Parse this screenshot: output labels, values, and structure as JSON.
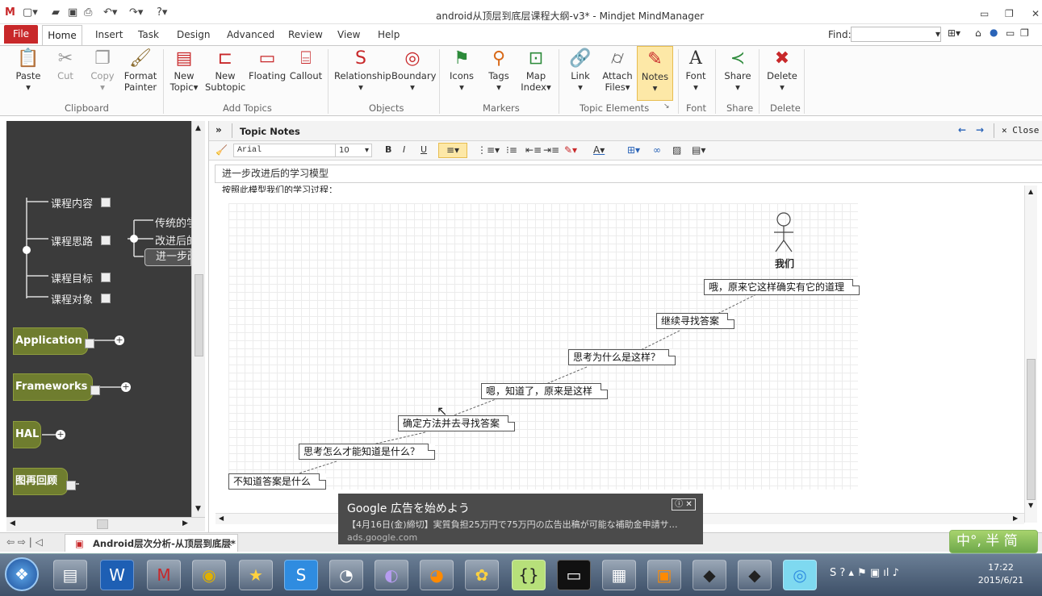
{
  "window": {
    "title": "android从顶层到底层课程大纲-v3* - Mindjet MindManager"
  },
  "menu": {
    "file": "File",
    "tabs": [
      "Home",
      "Insert",
      "Task",
      "Design",
      "Advanced",
      "Review",
      "View",
      "Help"
    ],
    "find_label": "Find:",
    "find_value": ""
  },
  "ribbon": {
    "paste": "Paste",
    "cut": "Cut",
    "copy": "Copy",
    "format_painter_1": "Format",
    "format_painter_2": "Painter",
    "new_topic_1": "New",
    "new_topic_2": "Topic",
    "new_subtopic_1": "New",
    "new_subtopic_2": "Subtopic",
    "floating": "Floating",
    "callout": "Callout",
    "relationship": "Relationship",
    "boundary": "Boundary",
    "icons": "Icons",
    "tags": "Tags",
    "map_index_1": "Map",
    "map_index_2": "Index",
    "link": "Link",
    "attach_1": "Attach",
    "attach_2": "Files",
    "notes": "Notes",
    "font": "Font",
    "share": "Share",
    "delete": "Delete",
    "groups": {
      "clipboard": "Clipboard",
      "add_topics": "Add Topics",
      "objects": "Objects",
      "markers": "Markers",
      "topic_elements": "Topic Elements",
      "font": "Font",
      "share": "Share",
      "delete": "Delete"
    }
  },
  "map": {
    "branches": [
      {
        "label": "课程内容"
      },
      {
        "label": "课程思路"
      },
      {
        "label": "课程目标"
      },
      {
        "label": "课程对象"
      }
    ],
    "sub_branches": [
      {
        "label": "传统的学"
      },
      {
        "label": "改进后的"
      },
      {
        "label": "进一步改"
      }
    ],
    "main_topics": [
      {
        "label": "Application"
      },
      {
        "label": "Frameworks"
      },
      {
        "label": "HAL"
      },
      {
        "label": "图再回顾"
      }
    ]
  },
  "doc_tab": {
    "label": "Android层次分析-从顶层到底层*"
  },
  "notes": {
    "panel_title": "Topic Notes",
    "close_label": "Close",
    "font_name": "Arial",
    "font_size": "10",
    "note_title": "进一步改进后的学习模型",
    "partial_line": "按照此模型我们的学习过程：",
    "actor_label": "我们",
    "steps": [
      "哦，原来它这样确实有它的道理",
      "继续寻找答案",
      "思考为什么是这样？",
      "嗯，知道了，原来是这样",
      "确定方法并去寻找答案",
      "思考怎么才能知道是什么？",
      "不知道答案是什么"
    ]
  },
  "ad": {
    "title": "Google 広告を始めよう",
    "desc": "【4月16日(金)締切】実質負担25万円で75万円の広告出稿が可能な補助金申請サ…",
    "url": "ads.google.com"
  },
  "ime": {
    "label": "中°, 半 简"
  },
  "clock": {
    "time": "17:22",
    "date": "2015/6/21"
  },
  "colors": {
    "file_tab": "#c8282a",
    "map_bg": "#3b3b3b",
    "topic_green": "#6f7d2f",
    "notes_highlight": "#fde8a7",
    "taskbar": "#3e5068"
  }
}
